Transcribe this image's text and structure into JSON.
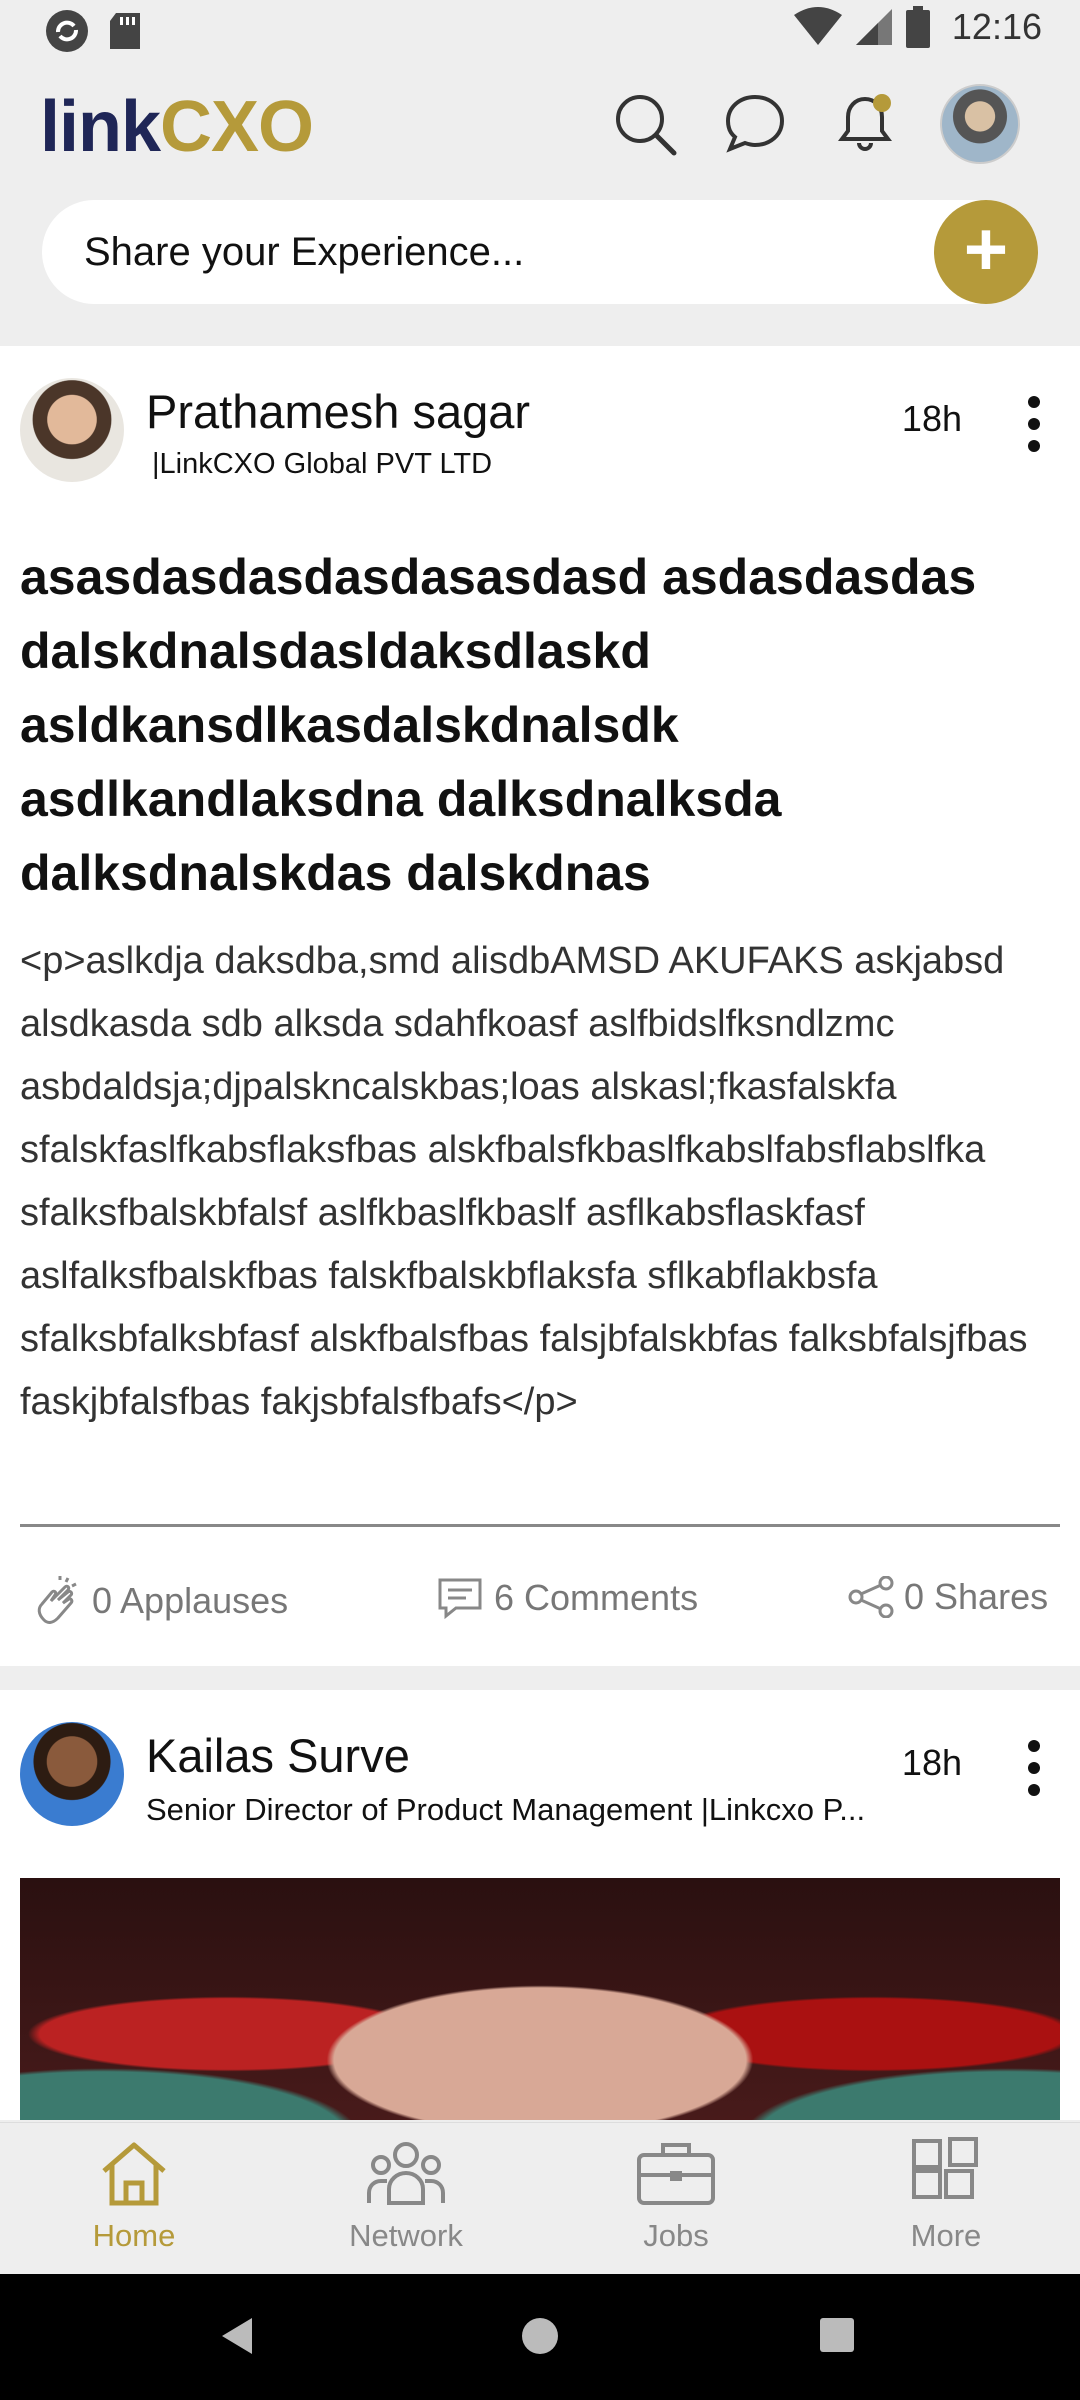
{
  "status": {
    "time": "12:16"
  },
  "header": {
    "logo_part1": "link",
    "logo_part2": "CXO",
    "icons": [
      "search-icon",
      "chat-icon",
      "bell-icon",
      "profile-avatar"
    ],
    "accent_color": "#b59a3a",
    "brand_color": "#1f2657"
  },
  "share": {
    "placeholder": "Share your Experience...",
    "button": "+"
  },
  "posts": [
    {
      "author": "Prathamesh sagar",
      "subtitle": "|LinkCXO Global PVT LTD",
      "time": "18h",
      "title": "asasdasdasdasdasasdasd asdasdasdas dalskdnalsdasldaksdlaskd asldkansdlkasdalskdnalsdk asdlkandlaksdna dalksdnalksda dalksdnalskdas dalskdnas",
      "body": "<p>aslkdja daksdba,smd alisdbAMSD AKUFAKS askjabsd alsdkasda sdb alksda sdahfkoasf aslfbidslfksndlzmc asbdaldsja;djpalskncalskbas;loas alskasl;fkasfalskfa sfalskfaslfkabsflaksfbas alskfbalsfkbaslfkabslfabsflabslfka sfalksfbalskbfalsf aslfkbaslfkbaslf asflkabsflaskfasf aslfalksfbalskfbas falskfbalskbflaksfa sflkabflakbsfa sfalksbfalksbfasf alskfbalsfbas falsjbfalskbfas falksbfalsjfbas faskjbfalsfbas fakjsbfalsfbafs</p>",
      "applauses": "0 Applauses",
      "comments": "6 Comments",
      "shares": "0 Shares"
    },
    {
      "author": "Kailas Surve",
      "subtitle": "Senior Director of Product Management |Linkcxo P...",
      "time": "18h"
    }
  ],
  "nav": [
    {
      "label": "Home",
      "icon": "home-icon",
      "active": true
    },
    {
      "label": "Network",
      "icon": "network-icon",
      "active": false
    },
    {
      "label": "Jobs",
      "icon": "briefcase-icon",
      "active": false
    },
    {
      "label": "More",
      "icon": "grid-icon",
      "active": false
    }
  ]
}
